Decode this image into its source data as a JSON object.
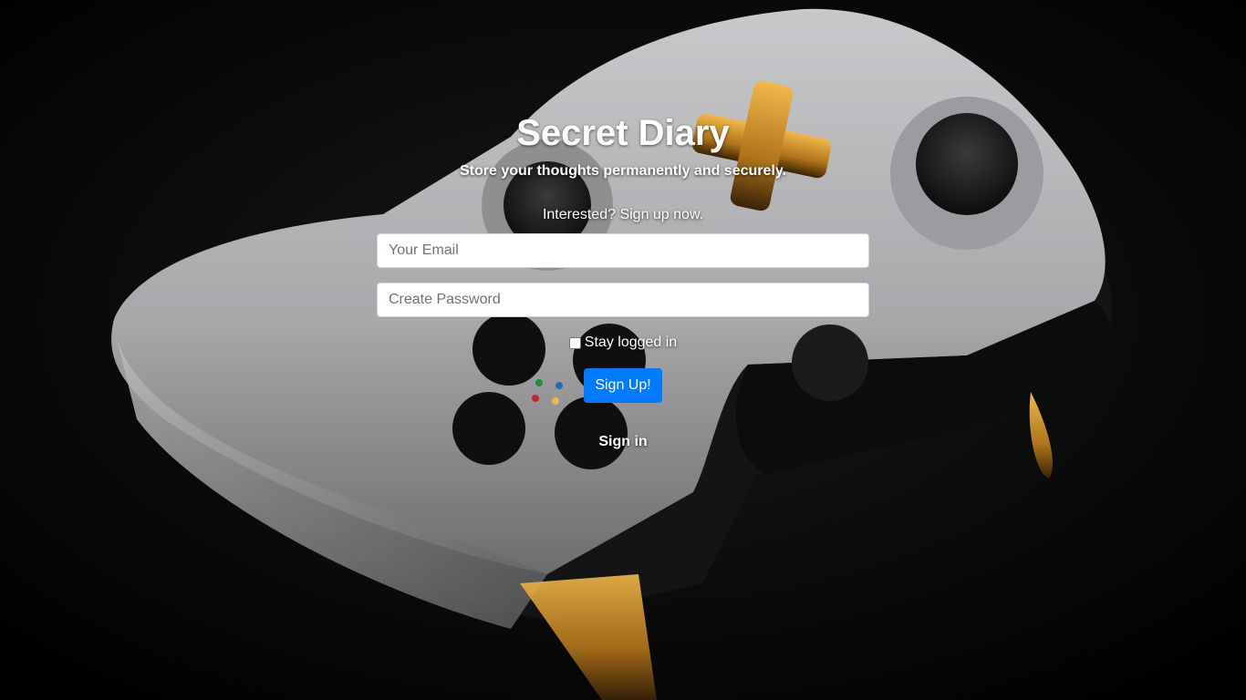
{
  "header": {
    "title": "Secret Diary",
    "tagline": "Store your thoughts permanently and securely."
  },
  "signup_form": {
    "prompt": "Interested? Sign up now.",
    "email_placeholder": "Your Email",
    "password_placeholder": "Create Password",
    "stay_logged_in_label": "Stay logged in",
    "stay_logged_in_checked": false,
    "submit_label": "Sign Up!",
    "toggle_link_label": "Sign in"
  },
  "colors": {
    "primary_button": "#007bff",
    "text": "#ffffff",
    "background": "#000000"
  },
  "background_image": "game-controller-photo"
}
